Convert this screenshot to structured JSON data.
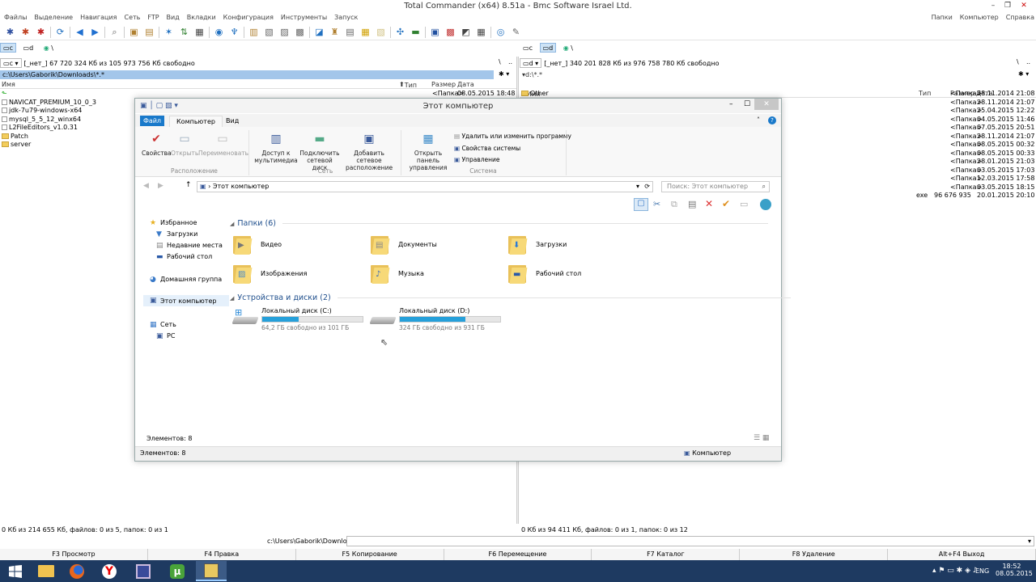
{
  "window": {
    "title": "Total Commander (x64) 8.51a - Bmc Software Israel Ltd.",
    "menu_left": [
      "Файлы",
      "Выделение",
      "Навигация",
      "Сеть",
      "FTP",
      "Вид",
      "Вкладки",
      "Конфигурация",
      "Инструменты",
      "Запуск"
    ],
    "menu_right": [
      "Папки",
      "Компьютер",
      "Справка"
    ]
  },
  "toolbar": {
    "icons": [
      "gear-icon",
      "gear2-icon",
      "gear3-icon",
      "refresh-icon",
      "back-icon",
      "forward-icon",
      "zoom-icon",
      "pack-icon",
      "unpack-icon",
      "compare-icon",
      "sync-icon",
      "notes-icon",
      "ftp-icon",
      "ftp2-icon",
      "view-icon",
      "edit-icon",
      "copy-icon",
      "move-icon",
      "mkdir-icon",
      "delete-icon",
      "rename-icon",
      "find-icon",
      "network-icon",
      "monitor-icon",
      "tools-icon",
      "terminal-icon",
      "globe-icon",
      "help-icon"
    ]
  },
  "left_panel": {
    "drive_c": "c",
    "drive_d": "d",
    "drive_net": "\\",
    "drive_sel": "c",
    "drive_label": "[_нет_]",
    "free": "67 720 324 Кб из 105 973 756 Кб свободно",
    "root": "\\",
    "up": "..",
    "path": "c:\\Users\\Gaborik\\Downloads\\*.*",
    "cols": {
      "name": "Имя",
      "ext": "Тип",
      "size": "Размер",
      "date": "Дата"
    },
    "up_size": "<Папка>",
    "up_date": "08.05.2015 18:48",
    "files": [
      "NAVICAT_PREMIUM_10_0_3",
      "jdk-7u79-windows-x64",
      "mysql_5_5_12_winx64",
      "L2FileEditors_v1.0.31",
      "Patch",
      "server"
    ],
    "status": "0 Кб из 214 655 Кб, файлов: 0 из 5, папок: 0 из 1"
  },
  "right_panel": {
    "drive_c": "c",
    "drive_d": "d",
    "drive_net": "\\",
    "drive_sel": "d",
    "drive_label": "[_нет_]",
    "free": "340 201 828 Кб из 976 758 780 Кб свободно",
    "root": "\\",
    "up": "..",
    "path": "d:\\*.*",
    "cols": {
      "name": "Имя",
      "ext": "Тип",
      "size": "Размер",
      "date": "Дата"
    },
    "first_folder": "Other",
    "rows": [
      {
        "ext": "",
        "size": "<Папка>",
        "date": "28.11.2014 21:08"
      },
      {
        "ext": "",
        "size": "<Папка>",
        "date": "28.11.2014 21:07"
      },
      {
        "ext": "",
        "size": "<Папка>",
        "date": "25.04.2015 12:22"
      },
      {
        "ext": "",
        "size": "<Папка>",
        "date": "04.05.2015 11:46"
      },
      {
        "ext": "",
        "size": "<Папка>",
        "date": "07.05.2015 20:51"
      },
      {
        "ext": "",
        "size": "<Папка>",
        "date": "28.11.2014 21:07"
      },
      {
        "ext": "",
        "size": "<Папка>",
        "date": "08.05.2015 00:32"
      },
      {
        "ext": "",
        "size": "<Папка>",
        "date": "08.05.2015 00:33"
      },
      {
        "ext": "",
        "size": "<Папка>",
        "date": "28.01.2015 21:03"
      },
      {
        "ext": "",
        "size": "<Папка>",
        "date": "03.05.2015 17:03"
      },
      {
        "ext": "",
        "size": "<Папка>",
        "date": "12.03.2015 17:58"
      },
      {
        "ext": "",
        "size": "<Папка>",
        "date": "03.05.2015 18:15"
      },
      {
        "ext": "exe",
        "size": "96 676 935",
        "date": "20.01.2015 20:10"
      }
    ],
    "status": "0 Кб из 94 411 Кб, файлов: 0 из 1, папок: 0 из 12"
  },
  "cmdline": {
    "path": "c:\\Users\\Gaborik\\Downloads>"
  },
  "fkeys": [
    "F3 Просмотр",
    "F4 Правка",
    "F5 Копирование",
    "F6 Перемещение",
    "F7 Каталог",
    "F8 Удаление",
    "Alt+F4 Выход"
  ],
  "explorer": {
    "title": "Этот компьютер",
    "tabs": {
      "file": "Файл",
      "computer": "Компьютер",
      "view": "Вид"
    },
    "ribbon": {
      "properties": "Свойства",
      "open": "Открыть",
      "rename": "Переименовать",
      "group_location": "Расположение",
      "media_access": "Доступ к мультимедиа",
      "map_drive": "Подключить сетевой диск",
      "add_location": "Добавить сетевое расположение",
      "group_network": "Сеть",
      "control_panel": "Открыть панель управления",
      "uninstall": "Удалить или изменить программу",
      "sys_props": "Свойства системы",
      "manage": "Управление",
      "group_system": "Система"
    },
    "address": "Этот компьютер",
    "search_placeholder": "Поиск: Этот компьютер",
    "nav": {
      "favorites": "Избранное",
      "downloads": "Загрузки",
      "recent": "Недавние места",
      "desktop": "Рабочий стол",
      "homegroup": "Домашняя группа",
      "this_pc": "Этот компьютер",
      "network": "Сеть",
      "pc": "PC"
    },
    "folders_header": "Папки (6)",
    "folders": [
      "Видео",
      "Документы",
      "Загрузки",
      "Изображения",
      "Музыка",
      "Рабочий стол"
    ],
    "drives_header": "Устройства и диски (2)",
    "drives": [
      {
        "name": "Локальный диск (C:)",
        "free": "64,2 ГБ свободно из 101 ГБ",
        "used_fraction": 0.36
      },
      {
        "name": "Локальный диск (D:)",
        "free": "324 ГБ свободно из 931 ГБ",
        "used_fraction": 0.65
      }
    ],
    "items_count": "Элементов: 8",
    "items_count2": "Элементов: 8",
    "status_right": "Компьютер"
  },
  "taskbar": {
    "lang": "ENG",
    "time": "18:52",
    "date": "08.05.2015"
  },
  "colors": {
    "tc_path_active": "#a3c6ea",
    "ribbon_file_tab": "#1979ca",
    "drive_bar": "#26a0da",
    "taskbar": "#1e3a61"
  }
}
